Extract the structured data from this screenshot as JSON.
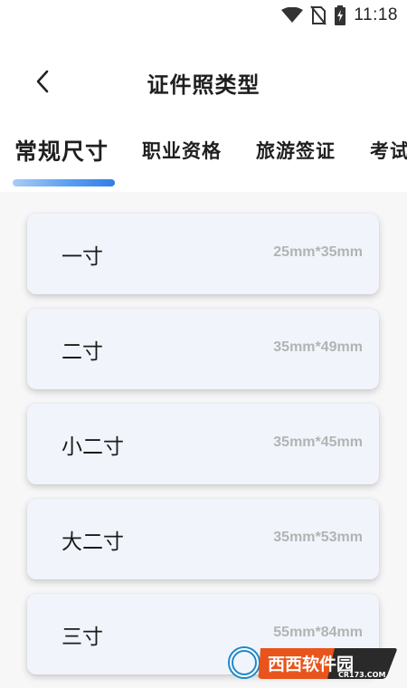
{
  "status_bar": {
    "time": "11:18",
    "icons": [
      "wifi-icon",
      "no-sim-icon",
      "battery-charging-icon"
    ]
  },
  "header": {
    "back_icon": "chevron-left-icon",
    "title": "证件照类型"
  },
  "tabs": [
    {
      "label": "常规尺寸",
      "active": true
    },
    {
      "label": "职业资格",
      "active": false
    },
    {
      "label": "旅游签证",
      "active": false
    },
    {
      "label": "考试",
      "active": false
    }
  ],
  "accent_color": "#2f7fe6",
  "sizes": [
    {
      "name": "一寸",
      "dimensions": "25mm*35mm"
    },
    {
      "name": "二寸",
      "dimensions": "35mm*49mm"
    },
    {
      "name": "小二寸",
      "dimensions": "35mm*45mm"
    },
    {
      "name": "大二寸",
      "dimensions": "35mm*53mm"
    },
    {
      "name": "三寸",
      "dimensions": "55mm*84mm"
    }
  ],
  "watermark": {
    "brand": "西西软件园",
    "site": "CR173.COM"
  }
}
